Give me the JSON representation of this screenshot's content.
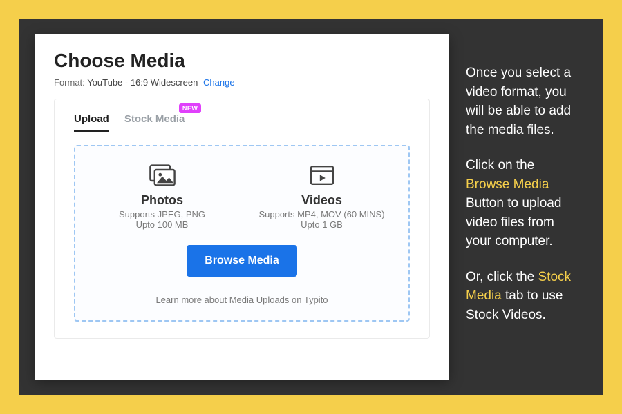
{
  "page": {
    "title": "Choose Media",
    "formatLabel": "Format:",
    "formatValue": "YouTube - 16:9 Widescreen",
    "changeLabel": "Change"
  },
  "tabs": {
    "upload": "Upload",
    "stock": "Stock Media",
    "newBadge": "NEW"
  },
  "photos": {
    "heading": "Photos",
    "supports": "Supports JPEG, PNG",
    "limit": "Upto 100 MB"
  },
  "videos": {
    "heading": "Videos",
    "supports": "Supports MP4, MOV (60 MINS)",
    "limit": "Upto 1 GB"
  },
  "actions": {
    "browse": "Browse Media",
    "learnMore": "Learn more about Media Uploads on Typito"
  },
  "caption": {
    "p1": "Once you select a video format, you will be able to add the media files.",
    "p2a": "Click on the ",
    "p2hl": "Browse Media",
    "p2b": " Button to upload video files from your computer.",
    "p3a": "Or, click the ",
    "p3hl": "Stock Media",
    "p3b": " tab to use Stock Videos."
  }
}
